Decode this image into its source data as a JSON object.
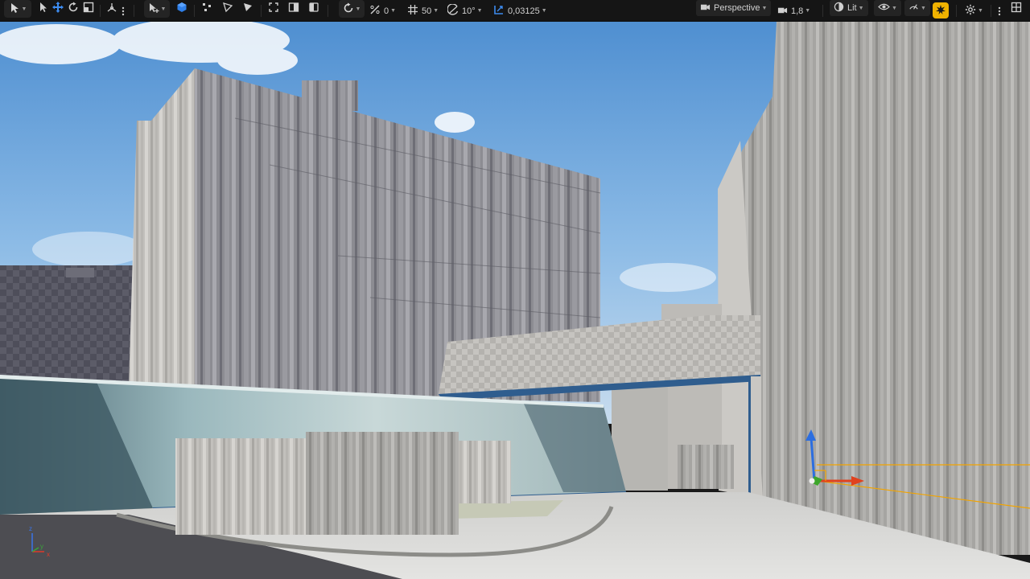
{
  "toolbar": {
    "snap_rotation_value": "0",
    "grid_snap_value": "50",
    "angle_snap_value": "10°",
    "scale_snap_value": "0,03125",
    "view_mode": "Perspective",
    "camera_speed": "1,8",
    "lit_mode": "Lit"
  },
  "axis_indicator": {
    "x": "x",
    "y": "y",
    "z": "z"
  },
  "colors": {
    "accent_orange": "#f0b200",
    "gizmo_x": "#e0421f",
    "gizmo_y": "#3da62a",
    "gizmo_z": "#2c6ee0",
    "select_outline": "#f2a400"
  }
}
